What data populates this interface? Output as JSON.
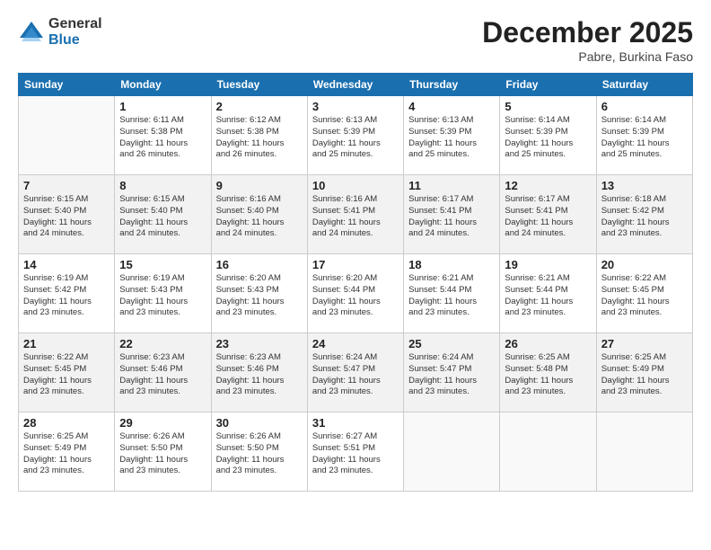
{
  "header": {
    "logo_general": "General",
    "logo_blue": "Blue",
    "month_title": "December 2025",
    "location": "Pabre, Burkina Faso"
  },
  "days_of_week": [
    "Sunday",
    "Monday",
    "Tuesday",
    "Wednesday",
    "Thursday",
    "Friday",
    "Saturday"
  ],
  "weeks": [
    [
      {
        "day": "",
        "info": ""
      },
      {
        "day": "1",
        "info": "Sunrise: 6:11 AM\nSunset: 5:38 PM\nDaylight: 11 hours\nand 26 minutes."
      },
      {
        "day": "2",
        "info": "Sunrise: 6:12 AM\nSunset: 5:38 PM\nDaylight: 11 hours\nand 26 minutes."
      },
      {
        "day": "3",
        "info": "Sunrise: 6:13 AM\nSunset: 5:39 PM\nDaylight: 11 hours\nand 25 minutes."
      },
      {
        "day": "4",
        "info": "Sunrise: 6:13 AM\nSunset: 5:39 PM\nDaylight: 11 hours\nand 25 minutes."
      },
      {
        "day": "5",
        "info": "Sunrise: 6:14 AM\nSunset: 5:39 PM\nDaylight: 11 hours\nand 25 minutes."
      },
      {
        "day": "6",
        "info": "Sunrise: 6:14 AM\nSunset: 5:39 PM\nDaylight: 11 hours\nand 25 minutes."
      }
    ],
    [
      {
        "day": "7",
        "info": "Sunrise: 6:15 AM\nSunset: 5:40 PM\nDaylight: 11 hours\nand 24 minutes."
      },
      {
        "day": "8",
        "info": "Sunrise: 6:15 AM\nSunset: 5:40 PM\nDaylight: 11 hours\nand 24 minutes."
      },
      {
        "day": "9",
        "info": "Sunrise: 6:16 AM\nSunset: 5:40 PM\nDaylight: 11 hours\nand 24 minutes."
      },
      {
        "day": "10",
        "info": "Sunrise: 6:16 AM\nSunset: 5:41 PM\nDaylight: 11 hours\nand 24 minutes."
      },
      {
        "day": "11",
        "info": "Sunrise: 6:17 AM\nSunset: 5:41 PM\nDaylight: 11 hours\nand 24 minutes."
      },
      {
        "day": "12",
        "info": "Sunrise: 6:17 AM\nSunset: 5:41 PM\nDaylight: 11 hours\nand 24 minutes."
      },
      {
        "day": "13",
        "info": "Sunrise: 6:18 AM\nSunset: 5:42 PM\nDaylight: 11 hours\nand 23 minutes."
      }
    ],
    [
      {
        "day": "14",
        "info": "Sunrise: 6:19 AM\nSunset: 5:42 PM\nDaylight: 11 hours\nand 23 minutes."
      },
      {
        "day": "15",
        "info": "Sunrise: 6:19 AM\nSunset: 5:43 PM\nDaylight: 11 hours\nand 23 minutes."
      },
      {
        "day": "16",
        "info": "Sunrise: 6:20 AM\nSunset: 5:43 PM\nDaylight: 11 hours\nand 23 minutes."
      },
      {
        "day": "17",
        "info": "Sunrise: 6:20 AM\nSunset: 5:44 PM\nDaylight: 11 hours\nand 23 minutes."
      },
      {
        "day": "18",
        "info": "Sunrise: 6:21 AM\nSunset: 5:44 PM\nDaylight: 11 hours\nand 23 minutes."
      },
      {
        "day": "19",
        "info": "Sunrise: 6:21 AM\nSunset: 5:44 PM\nDaylight: 11 hours\nand 23 minutes."
      },
      {
        "day": "20",
        "info": "Sunrise: 6:22 AM\nSunset: 5:45 PM\nDaylight: 11 hours\nand 23 minutes."
      }
    ],
    [
      {
        "day": "21",
        "info": "Sunrise: 6:22 AM\nSunset: 5:45 PM\nDaylight: 11 hours\nand 23 minutes."
      },
      {
        "day": "22",
        "info": "Sunrise: 6:23 AM\nSunset: 5:46 PM\nDaylight: 11 hours\nand 23 minutes."
      },
      {
        "day": "23",
        "info": "Sunrise: 6:23 AM\nSunset: 5:46 PM\nDaylight: 11 hours\nand 23 minutes."
      },
      {
        "day": "24",
        "info": "Sunrise: 6:24 AM\nSunset: 5:47 PM\nDaylight: 11 hours\nand 23 minutes."
      },
      {
        "day": "25",
        "info": "Sunrise: 6:24 AM\nSunset: 5:47 PM\nDaylight: 11 hours\nand 23 minutes."
      },
      {
        "day": "26",
        "info": "Sunrise: 6:25 AM\nSunset: 5:48 PM\nDaylight: 11 hours\nand 23 minutes."
      },
      {
        "day": "27",
        "info": "Sunrise: 6:25 AM\nSunset: 5:49 PM\nDaylight: 11 hours\nand 23 minutes."
      }
    ],
    [
      {
        "day": "28",
        "info": "Sunrise: 6:25 AM\nSunset: 5:49 PM\nDaylight: 11 hours\nand 23 minutes."
      },
      {
        "day": "29",
        "info": "Sunrise: 6:26 AM\nSunset: 5:50 PM\nDaylight: 11 hours\nand 23 minutes."
      },
      {
        "day": "30",
        "info": "Sunrise: 6:26 AM\nSunset: 5:50 PM\nDaylight: 11 hours\nand 23 minutes."
      },
      {
        "day": "31",
        "info": "Sunrise: 6:27 AM\nSunset: 5:51 PM\nDaylight: 11 hours\nand 23 minutes."
      },
      {
        "day": "",
        "info": ""
      },
      {
        "day": "",
        "info": ""
      },
      {
        "day": "",
        "info": ""
      }
    ]
  ]
}
